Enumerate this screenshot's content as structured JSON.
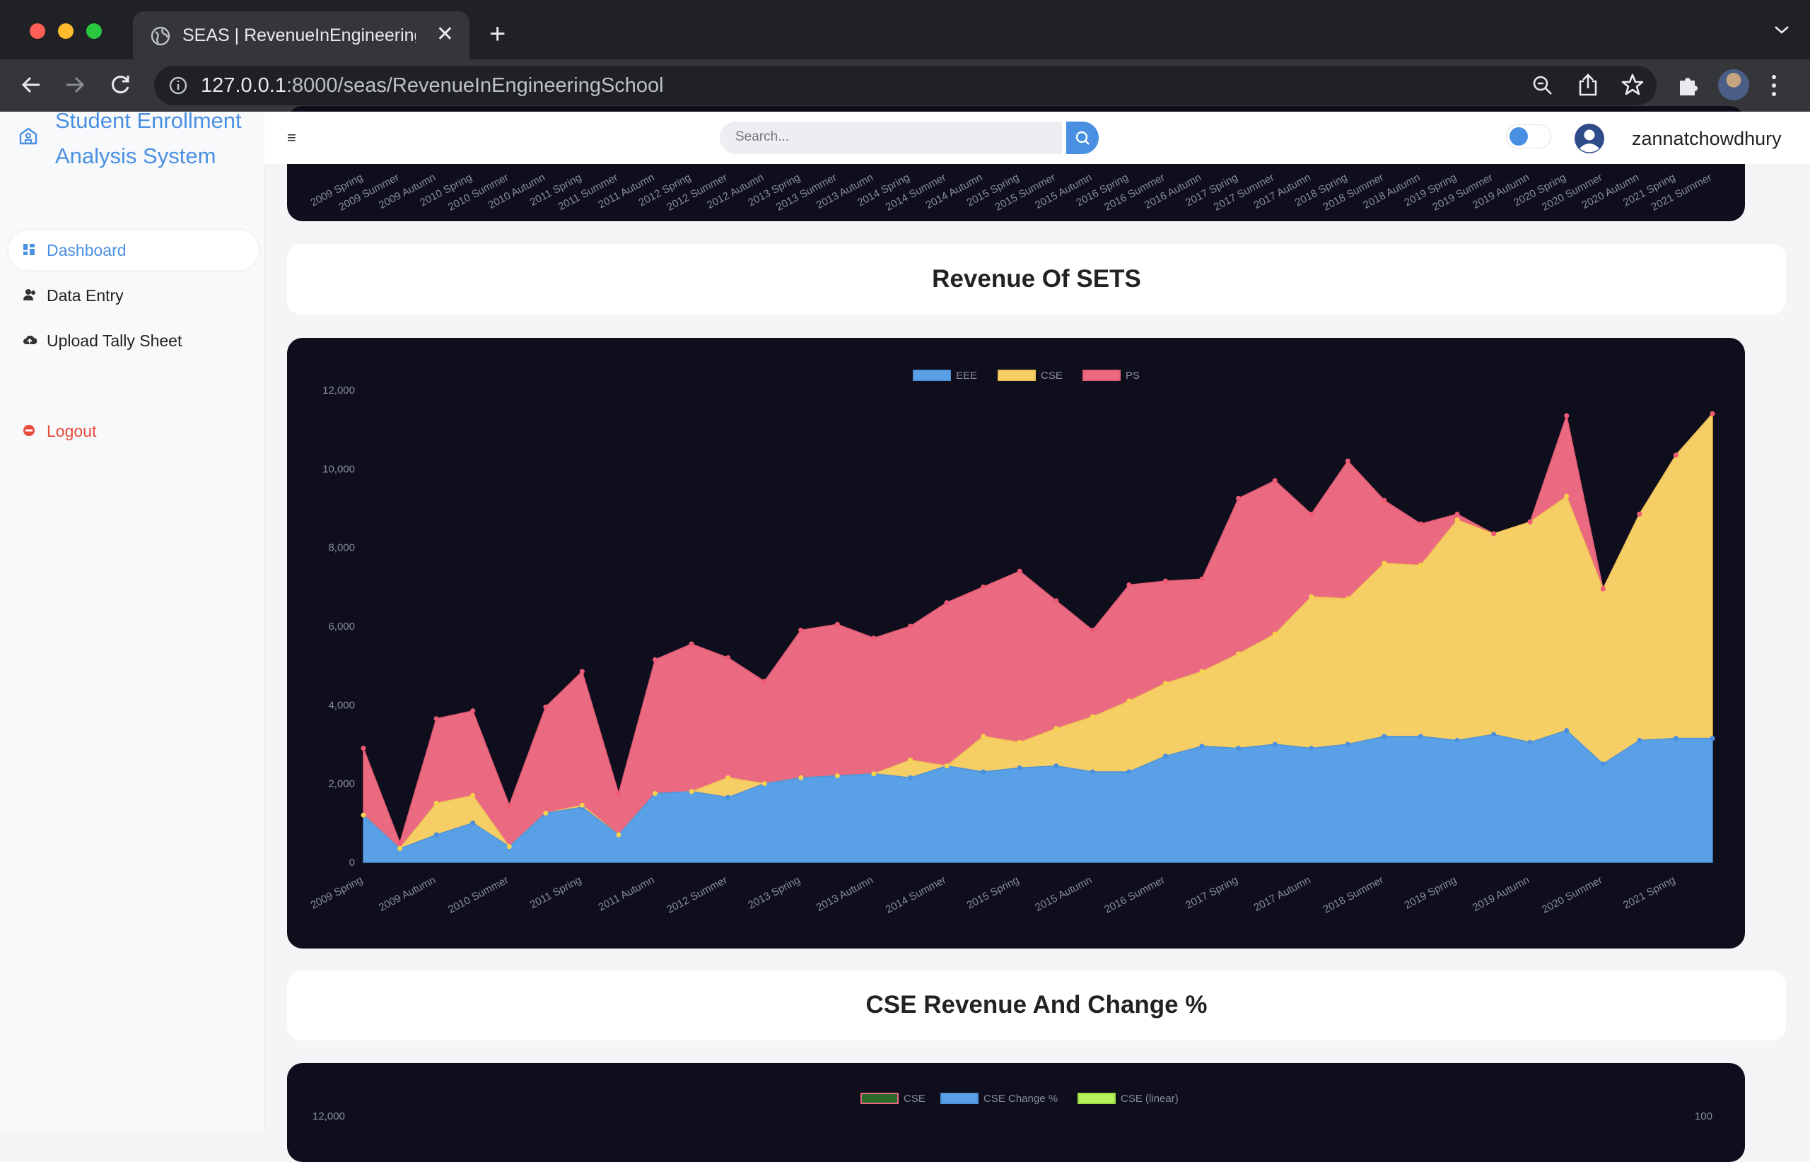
{
  "browser": {
    "tab_title": "SEAS | RevenueInEngineeringSchool",
    "url_host": "127.0.0.1",
    "url_rest": ":8000/seas/RevenueInEngineeringSchool"
  },
  "sidebar": {
    "brand_line1": "Student Enrollment",
    "brand_line2": "Analysis System",
    "items": [
      {
        "label": "Dashboard"
      },
      {
        "label": "Data Entry"
      },
      {
        "label": "Upload Tally Sheet"
      },
      {
        "label": "Logout"
      }
    ]
  },
  "header": {
    "search_placeholder": "Search...",
    "username": "zannatchowdhury"
  },
  "sections": {
    "revenue_title": "Revenue Of SETS",
    "cse_title": "CSE Revenue And Change %"
  },
  "colors": {
    "accent": "#4a90e2",
    "card_dark": "#0e0e1c",
    "eee": "#5aa0e6",
    "cse": "#f6ce66",
    "ps": "#ea6a82",
    "cse_change": "#5aa0e6",
    "cse_linear": "#b7f25a"
  },
  "chart_data": [
    {
      "type": "area",
      "stacked": true,
      "x": [
        "2009 Spring",
        "2009 Summer",
        "2009 Autumn",
        "2010 Spring",
        "2010 Summer",
        "2010 Autumn",
        "2011 Spring",
        "2011 Summer",
        "2011 Autumn",
        "2012 Spring",
        "2012 Summer",
        "2012 Autumn",
        "2013 Spring",
        "2013 Summer",
        "2013 Autumn",
        "2014 Spring",
        "2014 Summer",
        "2014 Autumn",
        "2015 Spring",
        "2015 Summer",
        "2015 Autumn",
        "2016 Spring",
        "2016 Summer",
        "2016 Autumn",
        "2017 Spring",
        "2017 Summer",
        "2017 Autumn",
        "2018 Spring",
        "2018 Summer",
        "2018 Autumn",
        "2019 Spring",
        "2019 Summer",
        "2019 Autumn",
        "2020 Spring",
        "2020 Summer",
        "2020 Autumn",
        "2021 Spring",
        "2021 Summer"
      ],
      "x_label_every": 2,
      "series": [
        {
          "name": "EEE",
          "values": [
            1200,
            350,
            700,
            1000,
            400,
            1250,
            1400,
            700,
            1750,
            1800,
            1650,
            2000,
            2150,
            2200,
            2250,
            2150,
            2450,
            2300,
            2400,
            2450,
            2300,
            2300,
            2700,
            2950,
            2900,
            3000,
            2900,
            3000,
            3200,
            3200,
            3100,
            3250,
            3050,
            3350,
            2500,
            3100,
            3150,
            3150
          ]
        },
        {
          "name": "CSE",
          "values": [
            0,
            0,
            800,
            700,
            0,
            0,
            50,
            0,
            0,
            0,
            500,
            0,
            0,
            0,
            0,
            450,
            0,
            900,
            650,
            950,
            1400,
            1800,
            1850,
            1900,
            2400,
            2800,
            3850,
            3700,
            4400,
            4350,
            5600,
            5100,
            5600,
            5950,
            4450,
            5750,
            7200,
            8250
          ]
        },
        {
          "name": "PS",
          "values": [
            1700,
            150,
            2150,
            2150,
            1050,
            2700,
            3400,
            1050,
            3400,
            3750,
            3050,
            2600,
            3750,
            3850,
            3450,
            3400,
            4150,
            3800,
            4350,
            3250,
            2200,
            2950,
            2600,
            2350,
            3950,
            3900,
            2100,
            3500,
            1600,
            1050,
            150,
            0,
            0,
            2050,
            0,
            0,
            0,
            0
          ]
        }
      ],
      "ylim": [
        0,
        12000
      ],
      "yticks": [
        "0",
        "2,000",
        "4,000",
        "6,000",
        "8,000",
        "10,000",
        "12,000"
      ],
      "legend": "top-center",
      "grid": false
    },
    {
      "type": "line",
      "series": [
        {
          "name": "CSE"
        },
        {
          "name": "CSE Change %"
        },
        {
          "name": "CSE (linear)"
        }
      ],
      "yticks_left_top": "12,000",
      "yticks_right_top": "100",
      "legend": "top-center"
    }
  ]
}
